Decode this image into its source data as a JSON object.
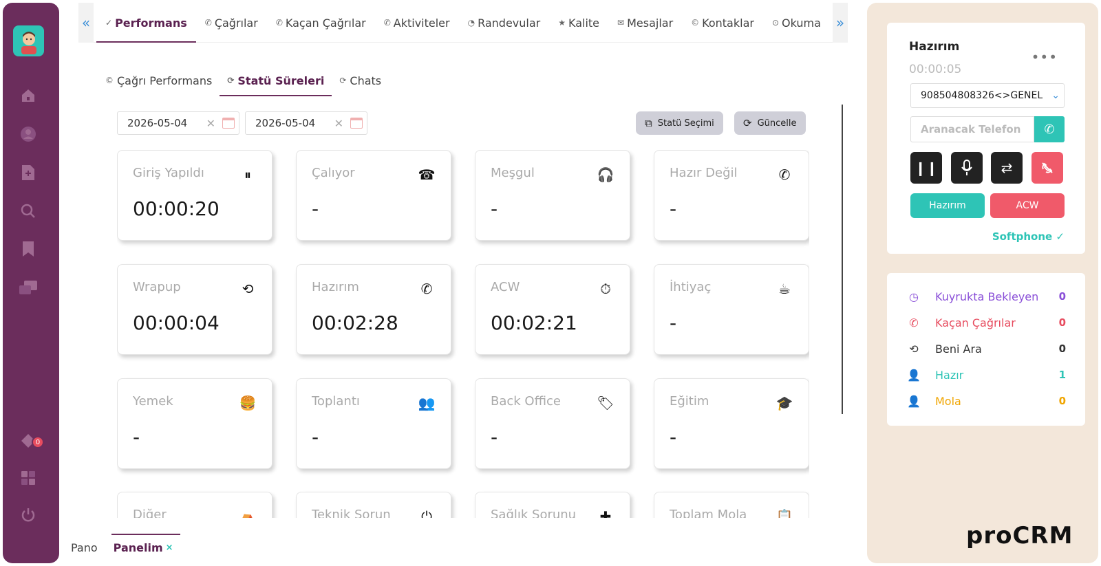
{
  "sidebar": {
    "items": [
      "home-icon",
      "user-icon",
      "add-document-icon",
      "search-icon",
      "bookmark-icon",
      "chat-icon",
      "tag-icon",
      "grid-icon",
      "power-icon"
    ],
    "notification_count": "0"
  },
  "topnav": {
    "tabs": [
      {
        "label": "Performans",
        "icon": "✓"
      },
      {
        "label": "Çağrılar",
        "icon": "✆"
      },
      {
        "label": "Kaçan Çağrılar",
        "icon": "✆"
      },
      {
        "label": "Aktiviteler",
        "icon": "✆"
      },
      {
        "label": "Randevular",
        "icon": "◔"
      },
      {
        "label": "Kalite",
        "icon": "★"
      },
      {
        "label": "Mesajlar",
        "icon": "✉"
      },
      {
        "label": "Kontaklar",
        "icon": "©"
      },
      {
        "label": "Okuma",
        "icon": "⊙"
      }
    ]
  },
  "subtabs": [
    {
      "label": "Çağrı Performans",
      "icon": "©"
    },
    {
      "label": "Statü Süreleri",
      "icon": "⟳"
    },
    {
      "label": "Chats",
      "icon": "⟳"
    }
  ],
  "filters": {
    "start_date": "2026-05-04",
    "end_date": "2026-05-04",
    "status_button": "Statü Seçimi",
    "refresh_button": "Güncelle"
  },
  "cards": [
    {
      "title": "Giriş Yapıldı",
      "value": "00:00:20",
      "icon": "⏸"
    },
    {
      "title": "Çalıyor",
      "value": "-",
      "icon": "☎"
    },
    {
      "title": "Meşgul",
      "value": "-",
      "icon": "🎧"
    },
    {
      "title": "Hazır Değil",
      "value": "-",
      "icon": "✆"
    },
    {
      "title": "Wrapup",
      "value": "00:00:04",
      "icon": "⟲"
    },
    {
      "title": "Hazırım",
      "value": "00:02:28",
      "icon": "✆"
    },
    {
      "title": "ACW",
      "value": "00:02:21",
      "icon": "⏱"
    },
    {
      "title": "İhtiyaç",
      "value": "-",
      "icon": "☕"
    },
    {
      "title": "Yemek",
      "value": "-",
      "icon": "🍔"
    },
    {
      "title": "Toplantı",
      "value": "-",
      "icon": "👥"
    },
    {
      "title": "Back Office",
      "value": "-",
      "icon": "🏷"
    },
    {
      "title": "Eğitim",
      "value": "-",
      "icon": "🎓"
    },
    {
      "title": "Diğer",
      "value": "",
      "icon": "⛺"
    },
    {
      "title": "Teknik Sorun",
      "value": "",
      "icon": "⏻"
    },
    {
      "title": "Sağlık Sorunu",
      "value": "",
      "icon": "✚"
    },
    {
      "title": "Toplam Mola",
      "value": "",
      "icon": "📋"
    }
  ],
  "bottomtabs": {
    "home": "Pano",
    "active": "Panelim",
    "close": "×"
  },
  "softphone": {
    "status": "Hazırım",
    "timer": "00:00:05",
    "more": "•••",
    "line": "908504808326<>GENEL",
    "phone_placeholder": "Aranacak Telefon",
    "ready_button": "Hazırım",
    "acw_button": "ACW",
    "softphone_label": "Softphone ✓",
    "colors": {
      "teal": "#2ec4b6",
      "red": "#f05a6a"
    }
  },
  "stats": [
    {
      "label": "Kuyrukta Bekleyen",
      "value": "0",
      "color": "#8a4fd8",
      "icon": "◷"
    },
    {
      "label": "Kaçan Çağrılar",
      "value": "0",
      "color": "#e74c5f",
      "icon": "✆"
    },
    {
      "label": "Beni Ara",
      "value": "0",
      "color": "#333333",
      "icon": "⟲"
    },
    {
      "label": "Hazır",
      "value": "1",
      "color": "#2ec4b6",
      "icon": "👤"
    },
    {
      "label": "Mola",
      "value": "0",
      "color": "#f0a500",
      "icon": "👤"
    }
  ],
  "brand": "proCRM"
}
